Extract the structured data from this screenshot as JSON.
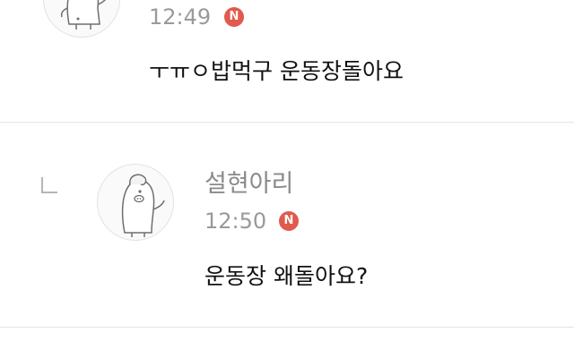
{
  "badge_color": "#e05a4e",
  "comments": [
    {
      "time": "12:49",
      "badge": "N",
      "text": "ㅜㅠㅇ밥먹구 운동장돌아요",
      "avatar_icon": "penguin-avatar-icon"
    },
    {
      "author": "설현아리",
      "time": "12:50",
      "badge": "N",
      "text": "운동장 왜돌아요?",
      "avatar_icon": "penguin-avatar-icon",
      "reply_icon": "reply-arrow-icon"
    }
  ]
}
